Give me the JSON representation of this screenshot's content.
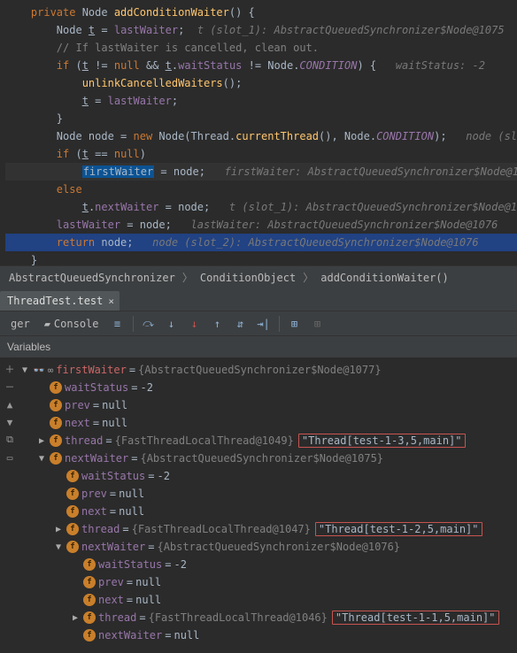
{
  "code": {
    "lines": [
      {
        "segs": [
          {
            "t": "    ",
            "c": ""
          },
          {
            "t": "private ",
            "c": "kw"
          },
          {
            "t": "Node ",
            "c": "cls"
          },
          {
            "t": "addConditionWaiter",
            "c": "meth"
          },
          {
            "t": "() {",
            "c": "ident"
          }
        ]
      },
      {
        "segs": [
          {
            "t": "        Node ",
            "c": "ident"
          },
          {
            "t": "t",
            "c": "ident underline"
          },
          {
            "t": " = ",
            "c": "ident"
          },
          {
            "t": "lastWaiter",
            "c": "field"
          },
          {
            "t": ";  ",
            "c": "ident"
          },
          {
            "t": "t (slot_1): AbstractQueuedSynchronizer$Node@1075",
            "c": "hint"
          }
        ]
      },
      {
        "segs": [
          {
            "t": "        ",
            "c": ""
          },
          {
            "t": "// If lastWaiter is cancelled, clean out.",
            "c": "comment"
          }
        ]
      },
      {
        "segs": [
          {
            "t": "        ",
            "c": ""
          },
          {
            "t": "if ",
            "c": "kw"
          },
          {
            "t": "(",
            "c": "ident"
          },
          {
            "t": "t",
            "c": "ident underline"
          },
          {
            "t": " != ",
            "c": "ident"
          },
          {
            "t": "null ",
            "c": "kw"
          },
          {
            "t": "&& ",
            "c": "ident"
          },
          {
            "t": "t",
            "c": "ident underline"
          },
          {
            "t": ".",
            "c": "ident"
          },
          {
            "t": "waitStatus",
            "c": "field"
          },
          {
            "t": " != Node.",
            "c": "ident"
          },
          {
            "t": "CONDITION",
            "c": "static-f"
          },
          {
            "t": ") {   ",
            "c": "ident"
          },
          {
            "t": "waitStatus: -2",
            "c": "hint"
          }
        ]
      },
      {
        "segs": [
          {
            "t": "            ",
            "c": ""
          },
          {
            "t": "unlinkCancelledWaiters",
            "c": "meth"
          },
          {
            "t": "();",
            "c": "ident"
          }
        ]
      },
      {
        "segs": [
          {
            "t": "            ",
            "c": ""
          },
          {
            "t": "t",
            "c": "ident underline"
          },
          {
            "t": " = ",
            "c": "ident"
          },
          {
            "t": "lastWaiter",
            "c": "field"
          },
          {
            "t": ";",
            "c": "ident"
          }
        ]
      },
      {
        "segs": [
          {
            "t": "        }",
            "c": "ident"
          }
        ]
      },
      {
        "segs": [
          {
            "t": "        Node node = ",
            "c": "ident"
          },
          {
            "t": "new ",
            "c": "kw"
          },
          {
            "t": "Node(Thread.",
            "c": "ident"
          },
          {
            "t": "currentThread",
            "c": "meth"
          },
          {
            "t": "(), Node.",
            "c": "ident"
          },
          {
            "t": "CONDITION",
            "c": "static-f"
          },
          {
            "t": ");   ",
            "c": "ident"
          },
          {
            "t": "node (sl",
            "c": "hint"
          }
        ]
      },
      {
        "segs": [
          {
            "t": "        ",
            "c": ""
          },
          {
            "t": "if ",
            "c": "kw"
          },
          {
            "t": "(",
            "c": "ident"
          },
          {
            "t": "t",
            "c": "ident underline"
          },
          {
            "t": " == ",
            "c": "ident"
          },
          {
            "t": "null",
            "c": "kw"
          },
          {
            "t": ")",
            "c": "ident"
          }
        ]
      },
      {
        "segs": [
          {
            "t": "            ",
            "c": ""
          },
          {
            "t": "firstWaiter",
            "c": "hi-var"
          },
          {
            "t": " = node;   ",
            "c": "ident"
          },
          {
            "t": "firstWaiter: AbstractQueuedSynchronizer$Node@1",
            "c": "hint"
          }
        ],
        "caret": true
      },
      {
        "segs": [
          {
            "t": "        ",
            "c": ""
          },
          {
            "t": "else",
            "c": "kw"
          }
        ]
      },
      {
        "segs": [
          {
            "t": "            ",
            "c": ""
          },
          {
            "t": "t",
            "c": "ident underline"
          },
          {
            "t": ".",
            "c": "ident"
          },
          {
            "t": "nextWaiter",
            "c": "field"
          },
          {
            "t": " = node;   ",
            "c": "ident"
          },
          {
            "t": "t (slot_1): AbstractQueuedSynchronizer$Node@1",
            "c": "hint"
          }
        ]
      },
      {
        "segs": [
          {
            "t": "        ",
            "c": ""
          },
          {
            "t": "lastWaiter",
            "c": "field"
          },
          {
            "t": " = node;   ",
            "c": "ident"
          },
          {
            "t": "lastWaiter: AbstractQueuedSynchronizer$Node@1076",
            "c": "hint"
          }
        ]
      },
      {
        "segs": [
          {
            "t": "        ",
            "c": ""
          },
          {
            "t": "return ",
            "c": "kw"
          },
          {
            "t": "node;   ",
            "c": "ident"
          },
          {
            "t": "node (slot_2): AbstractQueuedSynchronizer$Node@1076",
            "c": "hint"
          }
        ],
        "sel": true
      },
      {
        "segs": [
          {
            "t": "    }",
            "c": "ident"
          }
        ]
      }
    ]
  },
  "breadcrumb": {
    "items": [
      "AbstractQueuedSynchronizer",
      "ConditionObject",
      "addConditionWaiter()"
    ]
  },
  "tab": {
    "label": "ThreadTest.test",
    "close": "×"
  },
  "toolbar": {
    "label_left": "ger",
    "console": "Console"
  },
  "vars_header": "Variables",
  "tree": [
    {
      "depth": 0,
      "arrow": "▼",
      "glasses": true,
      "icon": "oo",
      "name": "firstWaiter",
      "eq": " = ",
      "valgray": "{AbstractQueuedSynchronizer$Node@1077}",
      "nameCls": "varname-red"
    },
    {
      "depth": 1,
      "arrow": "",
      "icon": "f",
      "name": "waitStatus",
      "eq": " = ",
      "valtxt": "-2"
    },
    {
      "depth": 1,
      "arrow": "",
      "icon": "f",
      "name": "prev",
      "eq": " = ",
      "valtxt": "null"
    },
    {
      "depth": 1,
      "arrow": "",
      "icon": "f",
      "name": "next",
      "eq": " = ",
      "valtxt": "null"
    },
    {
      "depth": 1,
      "arrow": "▶",
      "icon": "f",
      "name": "thread",
      "eq": " = ",
      "valgray": "{FastThreadLocalThread@1049}",
      "boxval": "\"Thread[test-1-3,5,main]\""
    },
    {
      "depth": 1,
      "arrow": "▼",
      "icon": "f",
      "name": "nextWaiter",
      "eq": " = ",
      "valgray": "{AbstractQueuedSynchronizer$Node@1075}"
    },
    {
      "depth": 2,
      "arrow": "",
      "icon": "f",
      "name": "waitStatus",
      "eq": " = ",
      "valtxt": "-2"
    },
    {
      "depth": 2,
      "arrow": "",
      "icon": "f",
      "name": "prev",
      "eq": " = ",
      "valtxt": "null"
    },
    {
      "depth": 2,
      "arrow": "",
      "icon": "f",
      "name": "next",
      "eq": " = ",
      "valtxt": "null"
    },
    {
      "depth": 2,
      "arrow": "▶",
      "icon": "f",
      "name": "thread",
      "eq": " = ",
      "valgray": "{FastThreadLocalThread@1047}",
      "boxval": "\"Thread[test-1-2,5,main]\""
    },
    {
      "depth": 2,
      "arrow": "▼",
      "icon": "f",
      "name": "nextWaiter",
      "eq": " = ",
      "valgray": "{AbstractQueuedSynchronizer$Node@1076}"
    },
    {
      "depth": 3,
      "arrow": "",
      "icon": "f",
      "name": "waitStatus",
      "eq": " = ",
      "valtxt": "-2"
    },
    {
      "depth": 3,
      "arrow": "",
      "icon": "f",
      "name": "prev",
      "eq": " = ",
      "valtxt": "null"
    },
    {
      "depth": 3,
      "arrow": "",
      "icon": "f",
      "name": "next",
      "eq": " = ",
      "valtxt": "null"
    },
    {
      "depth": 3,
      "arrow": "▶",
      "icon": "f",
      "name": "thread",
      "eq": " = ",
      "valgray": "{FastThreadLocalThread@1046}",
      "boxval": "\"Thread[test-1-1,5,main]\""
    },
    {
      "depth": 3,
      "arrow": "",
      "icon": "f",
      "name": "nextWaiter",
      "eq": " = ",
      "valtxt": "null"
    }
  ]
}
